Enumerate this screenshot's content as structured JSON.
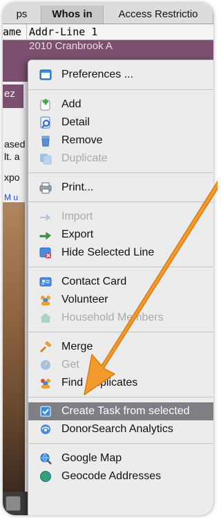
{
  "tabs": [
    {
      "label": "ps"
    },
    {
      "label": "Whos in"
    },
    {
      "label": "Access Restrictio"
    }
  ],
  "table": {
    "col_name": "ame",
    "col_addr": "Addr-Line 1",
    "row_partial": "2010 Cranbrook A"
  },
  "sidebar": {
    "sel_text": "ez",
    "text1": "ased",
    "text2": "lt. a",
    "text3": "xpo",
    "link": "M u"
  },
  "menu": {
    "preferences": "Preferences ...",
    "add": "Add",
    "detail": "Detail",
    "remove": "Remove",
    "duplicate": "Duplicate",
    "print": "Print...",
    "import": "Import",
    "export": "Export",
    "hide_selected": "Hide Selected Line",
    "contact_card": "Contact Card",
    "volunteer": "Volunteer",
    "household": "Household Members",
    "merge": "Merge",
    "get": "Get",
    "find_duplicates": "Find Duplicates",
    "create_task": "Create Task from selected",
    "donorsearch": "DonorSearch Analytics",
    "google_map": "Google Map",
    "geocode": "Geocode Addresses"
  },
  "colors": {
    "arrow": "#f39a2c",
    "highlight": "#7d7f85",
    "selected_row": "#7c4f6f"
  }
}
